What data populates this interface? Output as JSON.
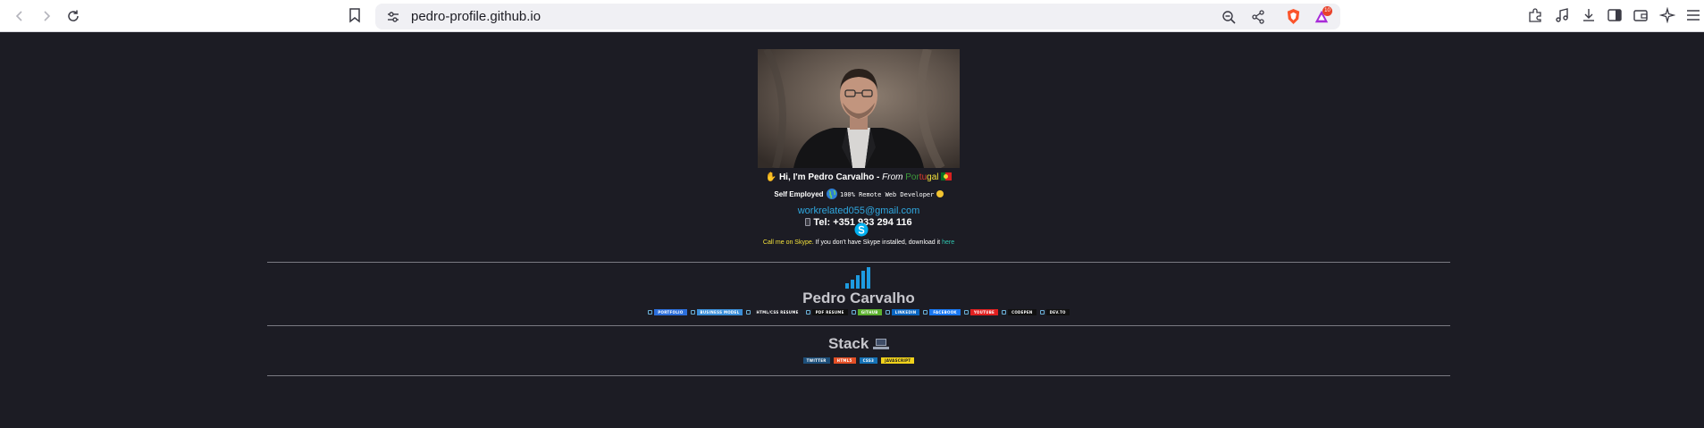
{
  "browser": {
    "url": "pedro-profile.github.io",
    "notification_count": "10"
  },
  "profile": {
    "greeting": "Hi, I'm Pedro Carvalho - ",
    "from_label": "From ",
    "country_parts": [
      "Por",
      "tu",
      "gal"
    ],
    "employment": "Self Employed",
    "remote_text": "100% Remote Web Developer",
    "email": "workrelated055@gmail.com",
    "tel": "Tel: +351 933 294 116",
    "skype_call": "Call me on Skype.",
    "skype_note": " If you don't have Skype installed, download it ",
    "skype_here": "here"
  },
  "links_section": {
    "heading": "Pedro Carvalho",
    "badges": [
      {
        "label": "PORTFOLIO",
        "color": "#2c6fdb"
      },
      {
        "label": "BUSINESS MODEL",
        "color": "#3a8ed8"
      },
      {
        "label": "HTML/CSS RESUME",
        "color": "#1c1c24"
      },
      {
        "label": "PDF RESUME",
        "color": "#111111"
      },
      {
        "label": "GITHUB",
        "color": "#5cb12f"
      },
      {
        "label": "LINKEDIN",
        "color": "#0a66c2"
      },
      {
        "label": "FACEBOOK",
        "color": "#1877f2"
      },
      {
        "label": "YOUTUBE",
        "color": "#e02020"
      },
      {
        "label": "CODEPEN",
        "color": "#111111"
      },
      {
        "label": "DEV.TO",
        "color": "#111111"
      }
    ]
  },
  "stack_section": {
    "heading": "Stack",
    "badges": [
      {
        "label": "TWITTER",
        "color": "#1d4f7a"
      },
      {
        "label": "HTML5",
        "color": "#e34f26"
      },
      {
        "label": "CSS3",
        "color": "#1572b6"
      },
      {
        "label": "JAVASCRIPT",
        "color": "#f0d21b"
      }
    ]
  }
}
